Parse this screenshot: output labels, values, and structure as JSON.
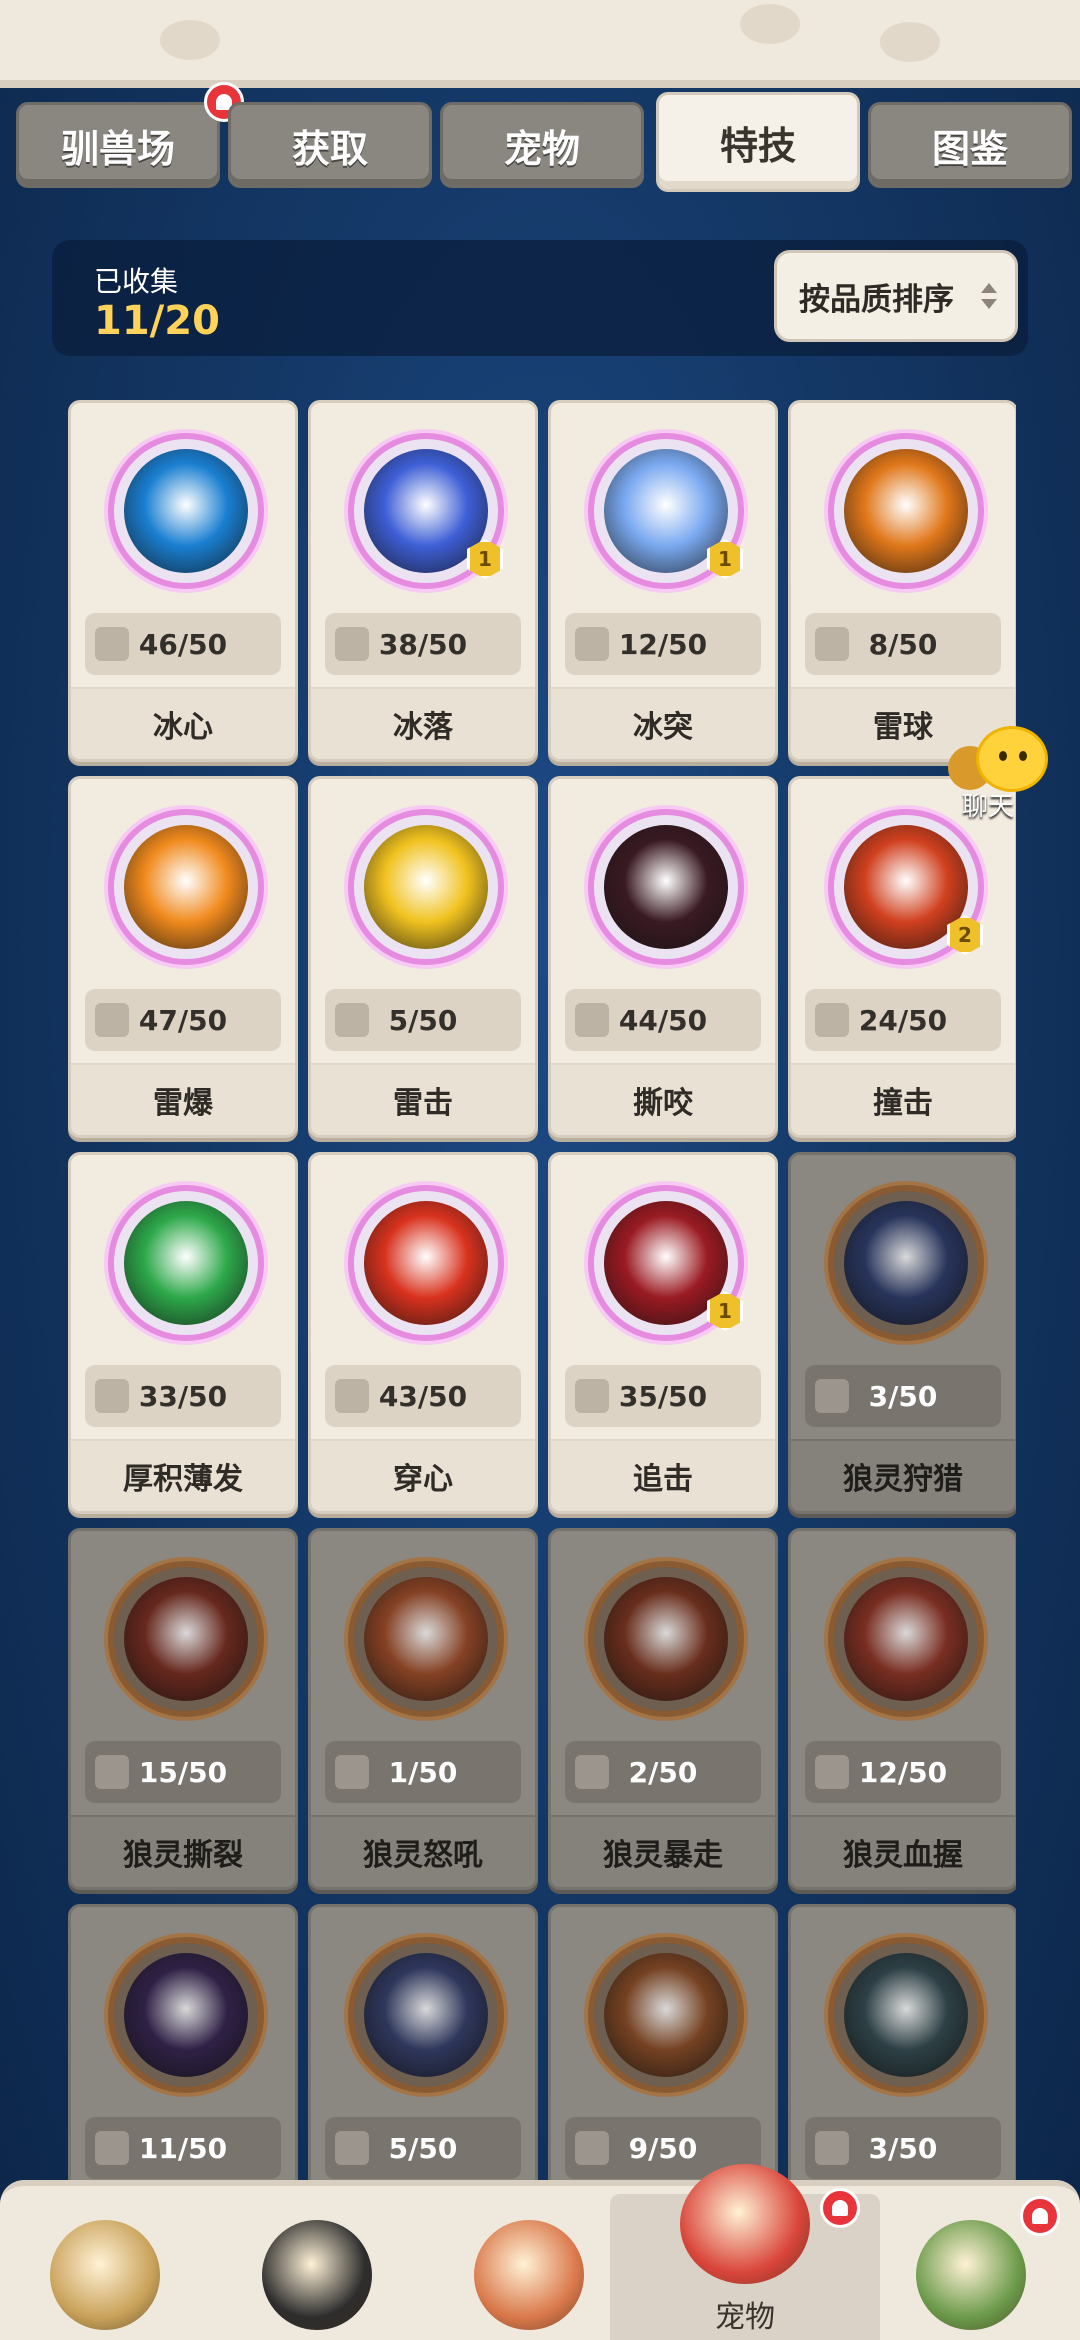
{
  "tabs": [
    {
      "label": "驯兽场",
      "has_notification": true
    },
    {
      "label": "获取",
      "has_notification": false
    },
    {
      "label": "宠物",
      "has_notification": false
    },
    {
      "label": "特技",
      "active": true
    },
    {
      "label": "图鉴",
      "has_notification": false
    }
  ],
  "collection": {
    "label": "已收集",
    "value": "11/20"
  },
  "sort": {
    "label": "按品质排序"
  },
  "chat": {
    "label": "聊天"
  },
  "skills": [
    {
      "name": "冰心",
      "progress": "46/50",
      "locked": false,
      "level": null,
      "icon": "snowflake-icon",
      "color": "#1a7fd1"
    },
    {
      "name": "冰落",
      "progress": "38/50",
      "locked": false,
      "level": "1",
      "icon": "ice-shard-icon",
      "color": "#3e5fd6"
    },
    {
      "name": "冰突",
      "progress": "12/50",
      "locked": false,
      "level": "1",
      "icon": "ice-crystal-icon",
      "color": "#7aa9f0"
    },
    {
      "name": "雷球",
      "progress": "8/50",
      "locked": false,
      "level": null,
      "icon": "thunder-orb-icon",
      "color": "#e0771a"
    },
    {
      "name": "雷爆",
      "progress": "47/50",
      "locked": false,
      "level": null,
      "icon": "thunder-blast-icon",
      "color": "#f08a1d"
    },
    {
      "name": "雷击",
      "progress": "5/50",
      "locked": false,
      "level": null,
      "icon": "lightning-strike-icon",
      "color": "#f0c21f"
    },
    {
      "name": "撕咬",
      "progress": "44/50",
      "locked": false,
      "level": null,
      "icon": "bite-jaws-icon",
      "color": "#3a1a22"
    },
    {
      "name": "撞击",
      "progress": "24/50",
      "locked": false,
      "level": "2",
      "icon": "impact-burst-icon",
      "color": "#d0401e"
    },
    {
      "name": "厚积薄发",
      "progress": "33/50",
      "locked": false,
      "level": null,
      "icon": "hourglass-icon",
      "color": "#2da84a"
    },
    {
      "name": "穿心",
      "progress": "43/50",
      "locked": false,
      "level": null,
      "icon": "fist-punch-icon",
      "color": "#d8321e"
    },
    {
      "name": "追击",
      "progress": "35/50",
      "locked": false,
      "level": "1",
      "icon": "pursuit-claw-icon",
      "color": "#9a1a22"
    },
    {
      "name": "狼灵狩猎",
      "progress": "3/50",
      "locked": true,
      "level": null,
      "icon": "wolf-hunt-icon",
      "color": "#2a3d7a"
    },
    {
      "name": "狼灵撕裂",
      "progress": "15/50",
      "locked": true,
      "level": null,
      "icon": "wolf-tear-icon",
      "color": "#8c2a1a"
    },
    {
      "name": "狼灵怒吼",
      "progress": "1/50",
      "locked": true,
      "level": null,
      "icon": "wolf-roar-icon",
      "color": "#b2481a"
    },
    {
      "name": "狼灵暴走",
      "progress": "2/50",
      "locked": true,
      "level": null,
      "icon": "wolf-rampage-icon",
      "color": "#8e3216"
    },
    {
      "name": "狼灵血握",
      "progress": "12/50",
      "locked": true,
      "level": null,
      "icon": "wolf-paw-icon",
      "color": "#a6301c"
    },
    {
      "name": "",
      "progress": "11/50",
      "locked": true,
      "level": null,
      "icon": "dark-star-icon",
      "color": "#3b245e"
    },
    {
      "name": "",
      "progress": "5/50",
      "locked": true,
      "level": null,
      "icon": "ghost-wolf-icon",
      "color": "#33407a"
    },
    {
      "name": "",
      "progress": "9/50",
      "locked": true,
      "level": null,
      "icon": "shadow-beast-icon",
      "color": "#9a4a18"
    },
    {
      "name": "",
      "progress": "3/50",
      "locked": true,
      "level": null,
      "icon": "claw-strike-icon",
      "color": "#2f4d55"
    }
  ],
  "bottom_nav": [
    {
      "label": "",
      "icon": "hero-yak-icon",
      "color": "#c9a25a"
    },
    {
      "label": "",
      "icon": "hero-ninja-icon",
      "color": "#2d2d2d"
    },
    {
      "label": "",
      "icon": "hero-chief-icon",
      "color": "#d9784a"
    },
    {
      "label": "宠物",
      "icon": "pet-dino-icon",
      "color": "#d9453a",
      "active": true,
      "has_notification": true
    },
    {
      "label": "",
      "icon": "hero-totem-icon",
      "color": "#6b9a4a",
      "has_notification": true
    }
  ]
}
